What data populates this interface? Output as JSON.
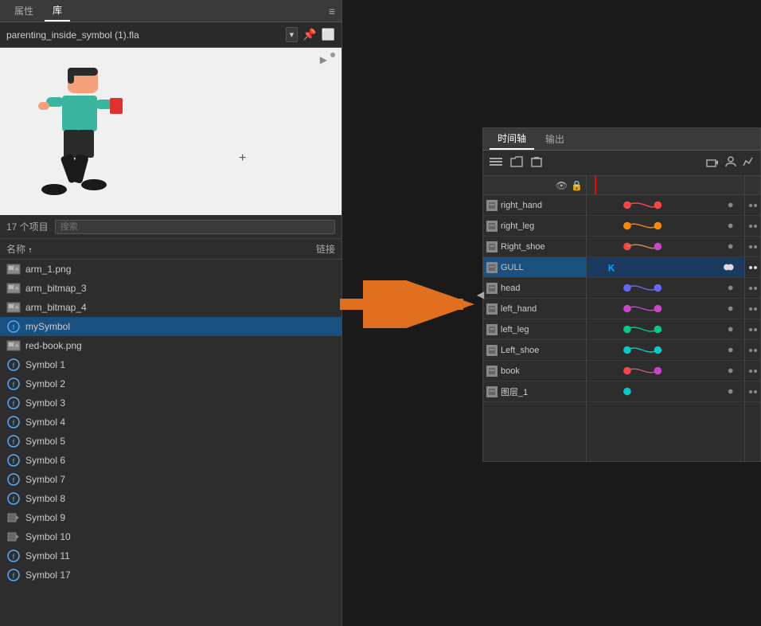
{
  "library": {
    "tabs": [
      {
        "label": "属性",
        "active": false
      },
      {
        "label": "库",
        "active": true
      }
    ],
    "menu_icon": "≡",
    "file": {
      "name": "parenting_inside_symbol (1).fla",
      "dropdown_symbol": "▾"
    },
    "item_count": "17 个项目",
    "search_placeholder": "搜索",
    "columns": {
      "name": "名称",
      "sort_arrow": "↑",
      "link": "链接"
    },
    "items": [
      {
        "id": "arm_1",
        "label": "arm_1.png",
        "type": "bitmap",
        "selected": false
      },
      {
        "id": "arm_bitmap_3",
        "label": "arm_bitmap_3",
        "type": "bitmap",
        "selected": false
      },
      {
        "id": "arm_bitmap_4",
        "label": "arm_bitmap_4",
        "type": "bitmap",
        "selected": false
      },
      {
        "id": "mySymbol",
        "label": "mySymbol",
        "type": "symbol_selected",
        "selected": true
      },
      {
        "id": "red_book",
        "label": "red-book.png",
        "type": "bitmap",
        "selected": false
      },
      {
        "id": "Symbol1",
        "label": "Symbol 1",
        "type": "symbol",
        "selected": false
      },
      {
        "id": "Symbol2",
        "label": "Symbol 2",
        "type": "symbol",
        "selected": false
      },
      {
        "id": "Symbol3",
        "label": "Symbol 3",
        "type": "symbol",
        "selected": false
      },
      {
        "id": "Symbol4",
        "label": "Symbol 4",
        "type": "symbol",
        "selected": false
      },
      {
        "id": "Symbol5",
        "label": "Symbol 5",
        "type": "symbol",
        "selected": false
      },
      {
        "id": "Symbol6",
        "label": "Symbol 6",
        "type": "symbol",
        "selected": false
      },
      {
        "id": "Symbol7",
        "label": "Symbol 7",
        "type": "symbol",
        "selected": false
      },
      {
        "id": "Symbol8",
        "label": "Symbol 8",
        "type": "symbol",
        "selected": false
      },
      {
        "id": "Symbol9",
        "label": "Symbol 9",
        "type": "video",
        "selected": false
      },
      {
        "id": "Symbol10",
        "label": "Symbol 10",
        "type": "video",
        "selected": false
      },
      {
        "id": "Symbol11",
        "label": "Symbol 11",
        "type": "symbol",
        "selected": false
      },
      {
        "id": "Symbol17",
        "label": "Symbol 17",
        "type": "symbol",
        "selected": false
      }
    ]
  },
  "timeline": {
    "tabs": [
      {
        "label": "时间轴",
        "active": true
      },
      {
        "label": "输出",
        "active": false
      }
    ],
    "toolbar_icons": [
      "layers",
      "folder",
      "delete"
    ],
    "right_icons": [
      "camera",
      "person",
      "chart"
    ],
    "layers": [
      {
        "name": "right_hand",
        "selected": false,
        "keyframes": [
          {
            "x": 40,
            "color": "#ff4444"
          },
          {
            "x": 80,
            "color": "#ff4444"
          }
        ]
      },
      {
        "name": "right_leg",
        "selected": false,
        "keyframes": [
          {
            "x": 40,
            "color": "#ff8800"
          },
          {
            "x": 80,
            "color": "#ff8800"
          }
        ]
      },
      {
        "name": "Right_shoe",
        "selected": false,
        "keyframes": [
          {
            "x": 40,
            "color": "#ff4444"
          },
          {
            "x": 80,
            "color": "#cc44cc"
          }
        ]
      },
      {
        "name": "GULL",
        "selected": true,
        "keyframes": [
          {
            "x": 15,
            "color": "#00aaff",
            "large": true
          }
        ]
      },
      {
        "name": "head",
        "selected": false,
        "keyframes": [
          {
            "x": 40,
            "color": "#6666ff"
          },
          {
            "x": 80,
            "color": "#6666ff"
          }
        ]
      },
      {
        "name": "left_hand",
        "selected": false,
        "keyframes": [
          {
            "x": 40,
            "color": "#cc44cc"
          },
          {
            "x": 80,
            "color": "#cc44cc"
          }
        ]
      },
      {
        "name": "left_leg",
        "selected": false,
        "keyframes": [
          {
            "x": 40,
            "color": "#00cc88"
          },
          {
            "x": 80,
            "color": "#00cc88"
          }
        ]
      },
      {
        "name": "Left_shoe",
        "selected": false,
        "keyframes": [
          {
            "x": 40,
            "color": "#00cccc"
          },
          {
            "x": 80,
            "color": "#00cccc"
          }
        ]
      },
      {
        "name": "book",
        "selected": false,
        "keyframes": [
          {
            "x": 40,
            "color": "#ff4444"
          },
          {
            "x": 80,
            "color": "#cc44cc"
          }
        ]
      },
      {
        "name": "图层_1",
        "selected": false,
        "keyframes": [
          {
            "x": 40,
            "color": "#00cccc"
          }
        ]
      }
    ]
  },
  "arrow": {
    "label": "→"
  }
}
